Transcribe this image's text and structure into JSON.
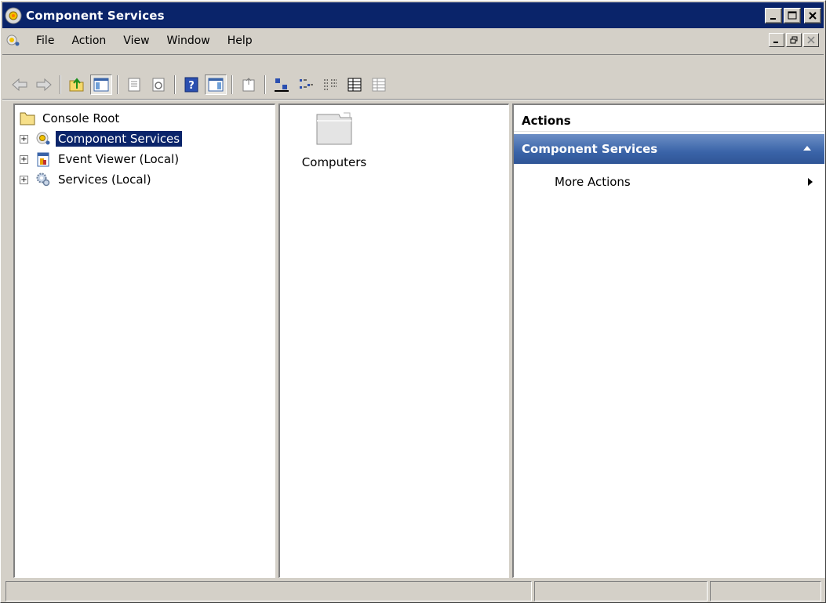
{
  "window": {
    "title": "Component Services"
  },
  "menu": {
    "items": [
      "File",
      "Action",
      "View",
      "Window",
      "Help"
    ]
  },
  "toolbar": {
    "buttons": [
      "back",
      "forward",
      "up-one-level",
      "show-hide-console-tree",
      "properties",
      "refresh",
      "help",
      "show-hide-action-pane",
      "export-list",
      "large-icons",
      "small-icons",
      "list",
      "detail",
      "properties-view"
    ]
  },
  "tree": {
    "root": {
      "label": "Console Root",
      "icon": "folder-icon"
    },
    "children": [
      {
        "label": "Component Services",
        "icon": "component-services-icon",
        "selected": true
      },
      {
        "label": "Event Viewer (Local)",
        "icon": "event-viewer-icon",
        "selected": false
      },
      {
        "label": "Services (Local)",
        "icon": "services-icon",
        "selected": false
      }
    ]
  },
  "list": {
    "items": [
      {
        "label": "Computers",
        "icon": "folder-icon"
      }
    ]
  },
  "actions": {
    "header": "Actions",
    "section": "Component Services",
    "items": [
      {
        "label": "More Actions"
      }
    ]
  },
  "status": {
    "cells": [
      "",
      "",
      ""
    ]
  },
  "colors": {
    "title_bar": "#0a246a",
    "face": "#d4d0c8",
    "action_section": "#3a64a8",
    "selection": "#0a246a"
  }
}
